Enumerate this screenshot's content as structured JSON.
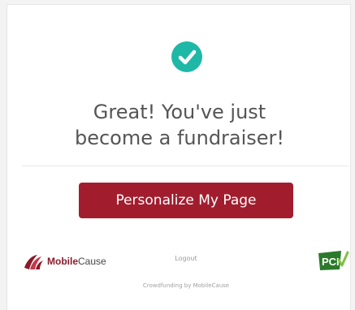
{
  "success_icon": {
    "icon": "check-circle-icon",
    "color": "#1fb8a7"
  },
  "headline": {
    "line1": "Great! You've just",
    "line2": "become a fundraiser!"
  },
  "cta": {
    "label": "Personalize My Page",
    "color": "#a11d2e"
  },
  "brand": {
    "logo_icon": "mobilecause-logo-icon",
    "name_bold": "Mobile",
    "name_light": "Cause",
    "color": "#8b1a2a"
  },
  "logout": {
    "label": "Logout"
  },
  "pci_badge": {
    "icon": "pci-badge-icon",
    "label": "PCI"
  },
  "footer": {
    "text": "Crowdfunding by MobileCause"
  }
}
